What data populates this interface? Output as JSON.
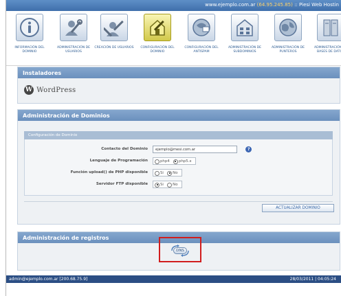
{
  "header": {
    "server_host": "www.ejemplo.com.ar",
    "server_ip": "(64.95.245.85)",
    "server_suffix": ":: Piesi Web Hostin"
  },
  "toolbar": {
    "items": [
      {
        "label": "INFORMACIÓN DEL DOMINIO",
        "icon": "info-icon",
        "active": false
      },
      {
        "label": "ADMINISTRACIÓN DE USUARIOS",
        "icon": "users-admin-icon",
        "active": false
      },
      {
        "label": "CREACIÓN DE USUARIOS",
        "icon": "user-create-icon",
        "active": false
      },
      {
        "label": "CONFIGURACIÓN DEL DOMINIO",
        "icon": "domain-config-icon",
        "active": true
      },
      {
        "label": "CONFIGURACIÓN DEL ANTISPAM",
        "icon": "antispam-icon",
        "active": false
      },
      {
        "label": "ADMINISTRACIÓN DE SUBDOMINIOS",
        "icon": "subdomains-icon",
        "active": false
      },
      {
        "label": "ADMINISTRACIÓN DE PUNTEROS",
        "icon": "pointers-icon",
        "active": false
      },
      {
        "label": "ADMINISTRACIÓN DE BASES DE DATOS",
        "icon": "databases-icon",
        "active": false
      }
    ]
  },
  "installers": {
    "title": "Instaladores",
    "wordpress_letter": "W",
    "wordpress_label": "WordPress"
  },
  "domains": {
    "title": "Administración de Dominios",
    "subtitle": "Configuración de Dominio",
    "contact_label": "Contacto del Dominio",
    "contact_value": "ejemplo@mesi.com.ar",
    "help_glyph": "?",
    "language_label": "Lenguaje de Programación",
    "language_options": [
      "php4",
      "php5.x"
    ],
    "upload_label": "Función upload() de PHP disponible",
    "ftp_label": "Servidor FTP disponible",
    "yes_label": "Si",
    "no_label": "No",
    "update_button": "ACTUALIZAR DOMINIO"
  },
  "records": {
    "title": "Administración de registros",
    "dns_label": "DNS"
  },
  "footer": {
    "user": "admin@ejemplo.com.ar [200.68.75.9]",
    "datetime": "28/03/2011 | 04:05:24"
  },
  "colors": {
    "header_bar": "#4f7fbb",
    "panel_header": "#7699c4",
    "footer_bar": "#2b4e84",
    "highlight_box": "#d11d1d",
    "active_tool": "#d2c94a"
  }
}
